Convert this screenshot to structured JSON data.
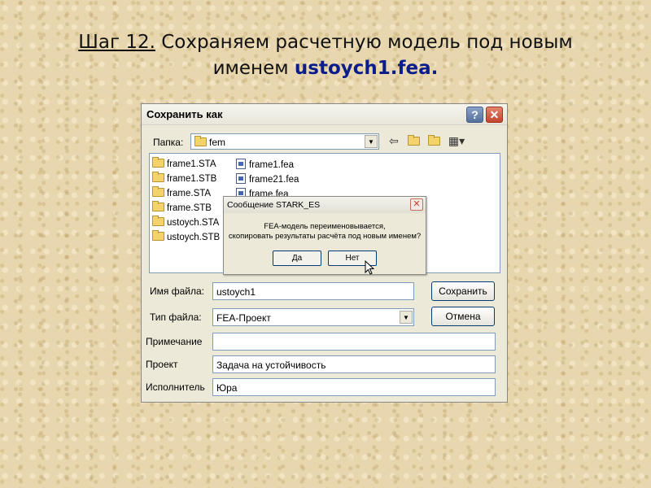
{
  "slide": {
    "step_label": "Шаг 12.",
    "title_rest": " Сохраняем расчетную модель под новым",
    "title_line2_prefix": "именем ",
    "filename": "ustoych1.fea",
    "title_line2_suffix": "."
  },
  "dialog": {
    "title": "Сохранить как",
    "help_label": "?",
    "close_label": "✕",
    "folder_label": "Папка:",
    "folder_value": "fem",
    "left_files": [
      "frame1.STA",
      "frame1.STB",
      "frame.STA",
      "frame.STB",
      "ustoych.STA",
      "ustoych.STB"
    ],
    "right_files": [
      "frame1.fea",
      "frame21.fea",
      "frame.fea"
    ],
    "filename_label": "Имя файла:",
    "filename_value": "ustoych1",
    "filetype_label": "Тип файла:",
    "filetype_value": "FEA-Проект",
    "save_button": "Сохранить",
    "cancel_button": "Отмена",
    "note_label": "Примечание",
    "note_value": "",
    "project_label": "Проект",
    "project_value": "Задача на устойчивость",
    "author_label": "Исполнитель",
    "author_value": "Юра"
  },
  "message_box": {
    "title": "Сообщение STARK_ES",
    "close_label": "✕",
    "line1": "FEA-модель переименовывается,",
    "line2": "скопировать результаты расчёта под новым именем?",
    "yes_button": "Да",
    "no_button": "Нет"
  }
}
